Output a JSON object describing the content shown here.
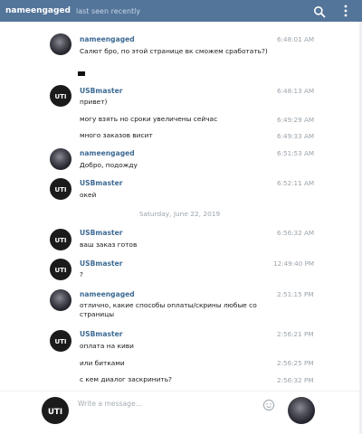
{
  "header": {
    "title": "nameengaged",
    "status": "last seen recently",
    "search_icon": "search-icon",
    "menu_icon": "more-vertical-icon"
  },
  "avatars": {
    "usbmaster_logo_text": "UTI"
  },
  "messages": [
    {
      "sender": "nameengaged",
      "text": "Салют бро, по этой странице вк сможем сработать?)",
      "time": "6:48:01 AM"
    },
    {
      "sender": "USBmaster",
      "text": "привет)",
      "time": "6:48:13 AM"
    },
    {
      "text": "могу взять но сроки увеличены сейчас",
      "time": "6:49:29 AM"
    },
    {
      "text": "много заказов висит",
      "time": "6:49:33 AM"
    },
    {
      "sender": "nameengaged",
      "text": "Добро, подожду",
      "time": "6:51:53 AM"
    },
    {
      "sender": "USBmaster",
      "text": "окей",
      "time": "6:52:11 AM"
    },
    {
      "sender": "USBmaster",
      "text": "ваш заказ готов",
      "time": "6:56:32 AM"
    },
    {
      "sender": "USBmaster",
      "text": "?",
      "time": "12:49:40 PM"
    },
    {
      "sender": "nameengaged",
      "text": "отлично, какие способы оплаты/скрины любые со страницы",
      "time": "2:51:15 PM"
    },
    {
      "sender": "USBmaster",
      "text": "оплата на киви",
      "time": "2:56:21 PM"
    },
    {
      "text": "или битками",
      "time": "2:56:25 PM"
    },
    {
      "text": "с кем диалог заскринить?",
      "time": "2:56:32 PM"
    }
  ],
  "date_separator": "Saturday, June 22, 2019",
  "composer": {
    "placeholder": "Write a message...",
    "emoji_icon": "emoji-icon"
  },
  "colors": {
    "header_bg": "#54759a",
    "sender_name": "#3d6a94",
    "timestamp": "#9aa3ab"
  }
}
